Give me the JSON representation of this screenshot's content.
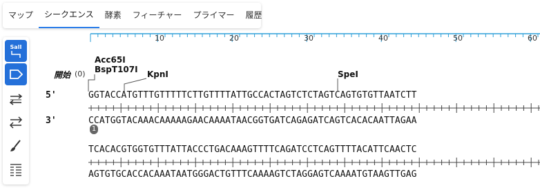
{
  "tabs": [
    "マップ",
    "シークエンス",
    "酵素",
    "フィーチャー",
    "プライマー",
    "履歴"
  ],
  "active_tab": 1,
  "toolbar": {
    "tools": [
      "restriction-site-icon",
      "feature-arrow-icon",
      "strand-swap-icon",
      "reverse-complement-icon",
      "brush-icon",
      "sequence-list-icon"
    ],
    "site_label": "SalI"
  },
  "ruler": {
    "labels": [
      "10",
      "20",
      "30",
      "40",
      "50",
      "60"
    ]
  },
  "start": {
    "label": "開始",
    "position": "(0)"
  },
  "enzymes": [
    "Acc65I",
    "BspT107I",
    "KpnI",
    "SpeI"
  ],
  "strands": {
    "forward": "5'",
    "reverse": "3'"
  },
  "block1": {
    "forward": "GGTACCATGTTTGTTTTTCTTGTTTTATTGCCACTAGTCTCTAGTCAGTGTGTTAATCTT",
    "reverse": "CCATGGTACAAACAAAAAGAACAAAATAACGGTGATCAGAGATCAGTCACACAATTAGAA",
    "badge": "1"
  },
  "block2": {
    "forward": "TCACACGTGGTGTTTATTACCCTGACAAAGTTTTCAGATCCTCAGTTTTACATTCAACTC",
    "reverse": "AGTGTGCACCACAAATAATGGGACTGTTTCAAAAGTCTAGGAGTCAAAATGTAAGTTGAG"
  },
  "colors": {
    "accent": "#2470d9",
    "ruler": "#2d9fd8",
    "tab_underline": "#2b7de9"
  }
}
